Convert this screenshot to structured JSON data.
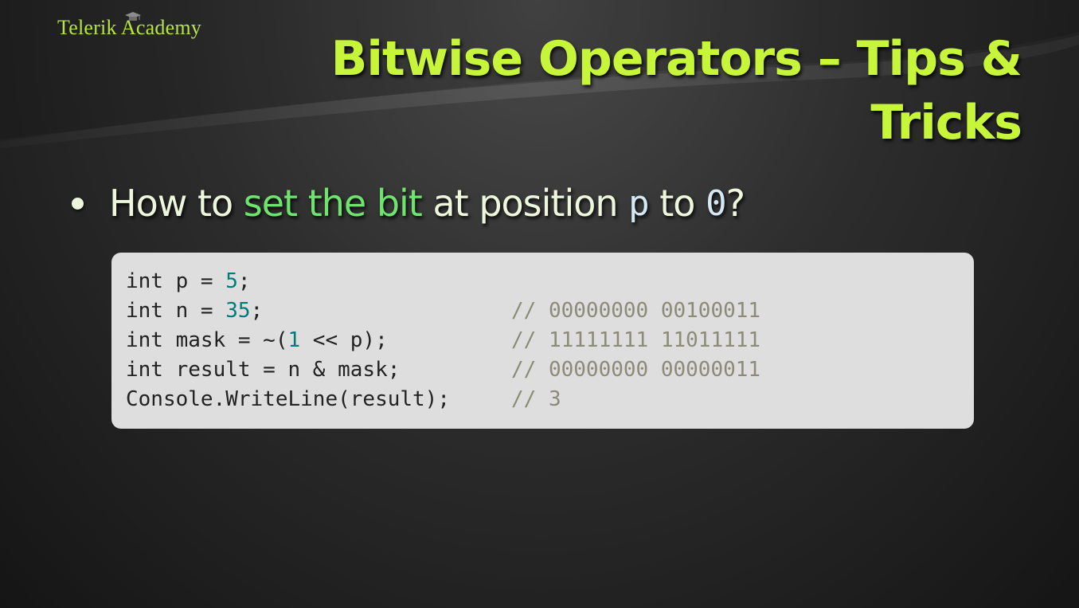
{
  "logo": {
    "text": "Telerik Academy"
  },
  "slide": {
    "title": "Bitwise Operators – Tips & Tricks",
    "bullet": {
      "text_before": "How to ",
      "highlight": "set the bit",
      "text_middle": " at position ",
      "code_p": "p",
      "text_to": " to ",
      "code_zero": "0",
      "text_end": "?"
    }
  },
  "code": {
    "lines": [
      {
        "parts": [
          "int p = ",
          "5",
          ";"
        ],
        "comment": ""
      },
      {
        "parts": [
          "int n = ",
          "35",
          ";"
        ],
        "comment": "// 00000000 00100011"
      },
      {
        "parts": [
          "int mask = ~(",
          "1",
          " << p);"
        ],
        "comment": "// 11111111 11011111"
      },
      {
        "parts": [
          "int result = n & mask;",
          "",
          ""
        ],
        "comment": "// 00000000 00000011"
      },
      {
        "parts": [
          "Console.WriteLine(result);",
          "",
          ""
        ],
        "comment": "// 3"
      }
    ]
  },
  "colors": {
    "title": "#c7f53a",
    "highlight": "#6ee46e",
    "number": "#007a7a",
    "comment": "#8b8b78"
  }
}
